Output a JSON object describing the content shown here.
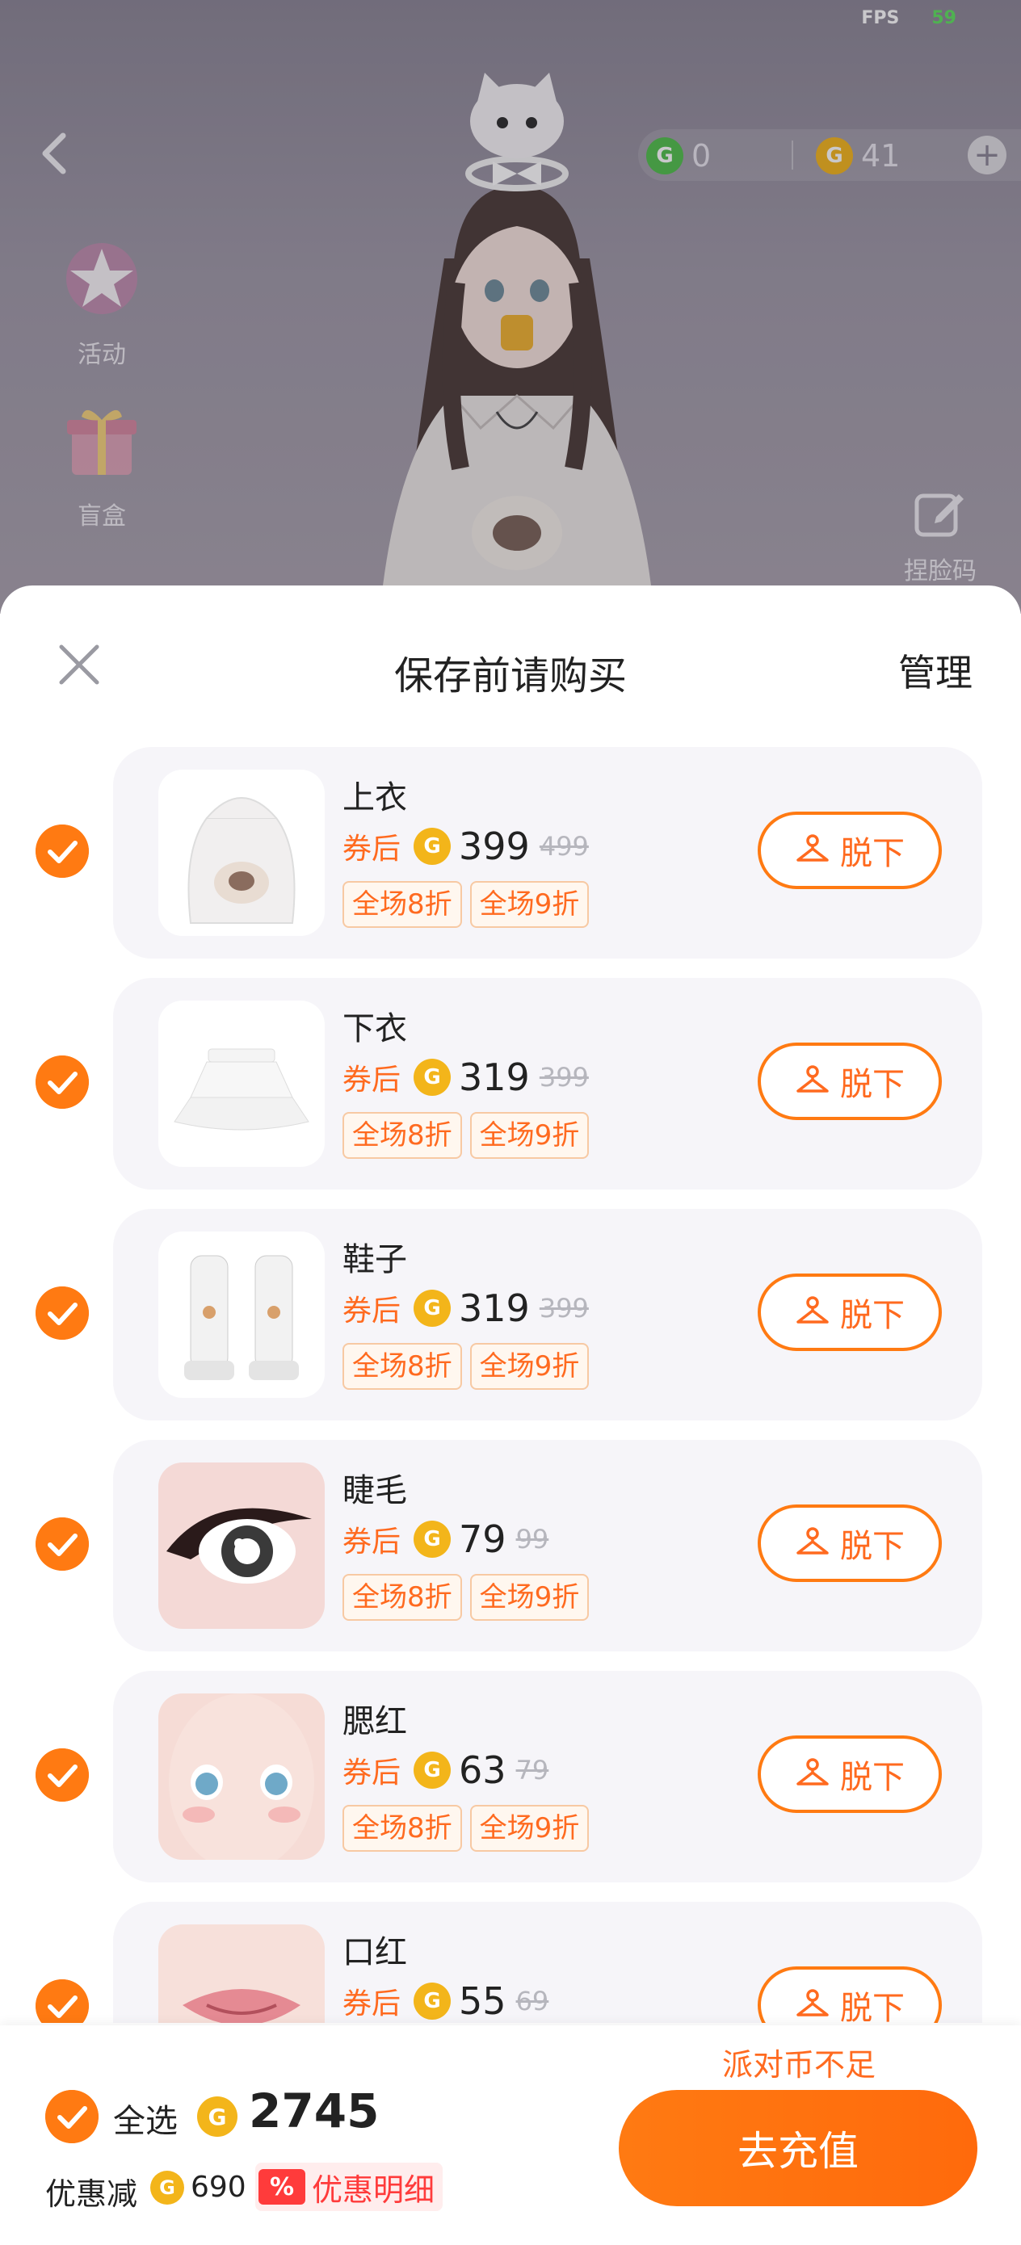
{
  "hud": {
    "fps_label": "FPS",
    "fps_value": "59",
    "currency_green": "0",
    "currency_gold": "41",
    "side_buttons": [
      {
        "label": "活动",
        "icon": "star-badge-icon"
      },
      {
        "label": "盲盒",
        "icon": "gift-box-icon"
      }
    ],
    "face_code_label": "捏脸码"
  },
  "sheet": {
    "title": "保存前请购买",
    "manage_label": "管理",
    "after_coupon_label": "券后",
    "tag_labels": [
      "全场8折",
      "全场9折"
    ],
    "takeoff_label": "脱下",
    "items": [
      {
        "name": "上衣",
        "price": "399",
        "original": "499",
        "thumb": "hoodie-thumb"
      },
      {
        "name": "下衣",
        "price": "319",
        "original": "399",
        "thumb": "skirt-thumb"
      },
      {
        "name": "鞋子",
        "price": "319",
        "original": "399",
        "thumb": "boots-thumb"
      },
      {
        "name": "睫毛",
        "price": "79",
        "original": "99",
        "thumb": "eyelash-thumb"
      },
      {
        "name": "腮红",
        "price": "63",
        "original": "79",
        "thumb": "blush-thumb"
      },
      {
        "name": "口红",
        "price": "55",
        "original": "69",
        "thumb": "lipstick-thumb"
      }
    ]
  },
  "footer": {
    "insufficient": "派对币不足",
    "select_all": "全选",
    "total": "2745",
    "discount_label": "优惠减",
    "discount_value": "690",
    "discount_badge": "%",
    "discount_detail": "优惠明细",
    "recharge_label": "去充值"
  },
  "colors": {
    "accent": "#ff7a12",
    "coin_gold": "#f3b51a",
    "coin_green": "#4fbf4a",
    "discount_red": "#ff3b3b"
  }
}
